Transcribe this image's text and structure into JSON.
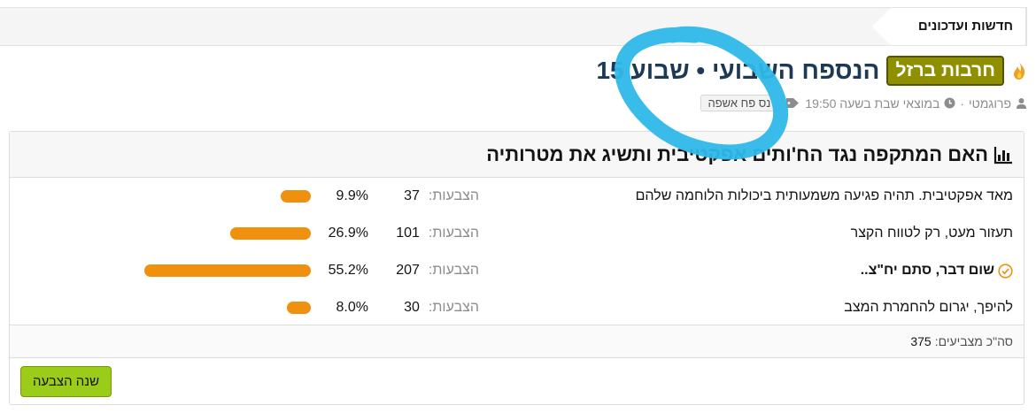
{
  "breadcrumb": {
    "label": "חדשות ועדכונים"
  },
  "thread": {
    "prefix": "חרבות ברזל",
    "title": "הנספח השבועי • שבוע 15",
    "author": "פרוגמטי",
    "date": "במוצאי שבת בשעה 19:50",
    "tag": "נס פח אשפה",
    "meta_separator": "·"
  },
  "poll": {
    "question": "האם המתקפה נגד הח'ותים אפקטיבית ותשיג את מטרותיה",
    "votes_label": "הצבעות:",
    "options": [
      {
        "label": "מאד אפקטיבית. תהיה פגיעה משמעותית ביכולות הלוחמה שלהם",
        "votes": "37",
        "percent": "9.9%",
        "value": 9.9,
        "selected": false
      },
      {
        "label": "תעזור מעט, רק לטווח הקצר",
        "votes": "101",
        "percent": "26.9%",
        "value": 26.9,
        "selected": false
      },
      {
        "label": "שום דבר, סתם יח\"צ..",
        "votes": "207",
        "percent": "55.2%",
        "value": 55.2,
        "selected": true
      },
      {
        "label": "להיפך, יגרום להחמרת המצב",
        "votes": "30",
        "percent": "8.0%",
        "value": 8.0,
        "selected": false
      }
    ],
    "total_label": "סה\"כ מצביעים:",
    "total_value": "375",
    "change_button": "שנה הצבעה"
  },
  "colors": {
    "bar": "#f0900f",
    "prefix_bg": "#8f8f00",
    "title": "#1c3a56",
    "button": "#9ccc1a",
    "scribble": "#2fb8ea"
  }
}
